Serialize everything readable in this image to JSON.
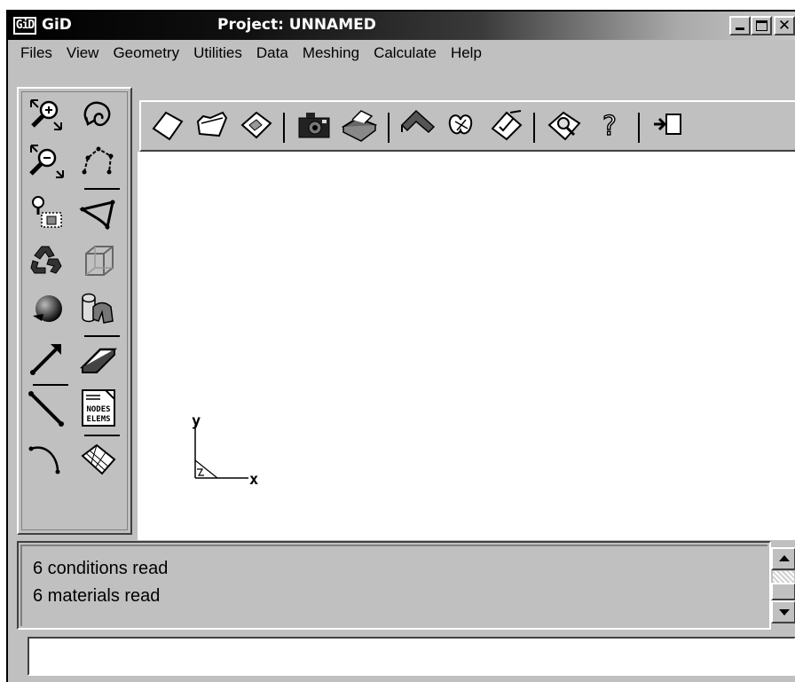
{
  "window": {
    "app_logo": "GiD",
    "app_name": "GiD",
    "title": "Project: UNNAMED",
    "buttons": {
      "minimize": "minimize",
      "maximize": "maximize",
      "close": "✕"
    }
  },
  "menu": [
    "Files",
    "View",
    "Geometry",
    "Utilities",
    "Data",
    "Meshing",
    "Calculate",
    "Help"
  ],
  "left_toolbar": {
    "icons": [
      "zoom-in-icon",
      "rotate-icon",
      "zoom-out-icon",
      "polyline-points-icon",
      "zoom-frame-icon",
      "surface-icon",
      "recycle-icon",
      "volume-cube-icon",
      "shading-icon",
      "layers-icon",
      "point-icon",
      "plane-surface-icon",
      "straight-line-icon",
      "nodes-elems-list-icon",
      "arc-icon",
      "mesh-surface-icon"
    ],
    "nodes_elems_label_top": "NODES",
    "nodes_elems_label_bottom": "ELEMS"
  },
  "top_toolbar": {
    "icons": [
      "new-icon",
      "open-icon",
      "save-icon",
      "snapshot-camera-icon",
      "print-icon",
      "surface-draw-icon",
      "render-icon",
      "edit-icon",
      "zoom-search-icon",
      "help-icon",
      "exit-icon"
    ],
    "help_glyph": "?"
  },
  "canvas": {
    "axis_y": "y",
    "axis_x": "x"
  },
  "log": {
    "lines": [
      "6 conditions read",
      "6 materials read"
    ]
  },
  "command": {
    "value": "",
    "placeholder": ""
  }
}
